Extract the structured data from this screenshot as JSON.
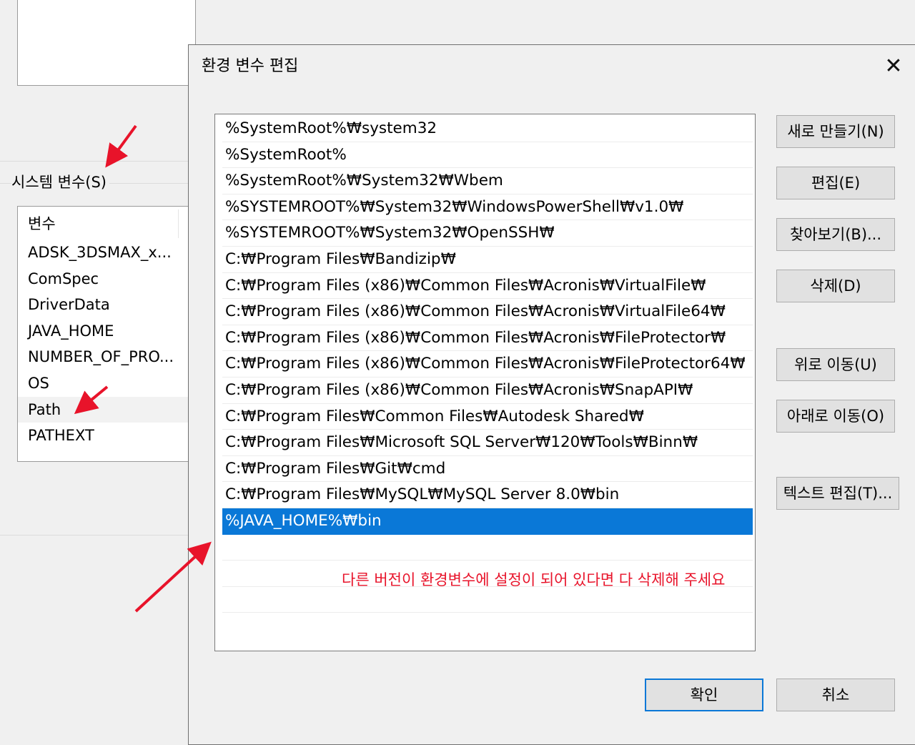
{
  "background": {
    "system_vars_group_label": "시스템 변수(S)",
    "list_header": "변수",
    "variables": [
      "ADSK_3DSMAX_x...",
      "ComSpec",
      "DriverData",
      "JAVA_HOME",
      "NUMBER_OF_PRO...",
      "OS",
      "Path",
      "PATHEXT"
    ],
    "highlighted_variable": "Path"
  },
  "dialog": {
    "title": "환경 변수 편집",
    "close_glyph": "✕",
    "entries": [
      "%SystemRoot%₩system32",
      "%SystemRoot%",
      "%SystemRoot%₩System32₩Wbem",
      "%SYSTEMROOT%₩System32₩WindowsPowerShell₩v1.0₩",
      "%SYSTEMROOT%₩System32₩OpenSSH₩",
      "C:₩Program Files₩Bandizip₩",
      "C:₩Program Files (x86)₩Common Files₩Acronis₩VirtualFile₩",
      "C:₩Program Files (x86)₩Common Files₩Acronis₩VirtualFile64₩",
      "C:₩Program Files (x86)₩Common Files₩Acronis₩FileProtector₩",
      "C:₩Program Files (x86)₩Common Files₩Acronis₩FileProtector64₩",
      "C:₩Program Files (x86)₩Common Files₩Acronis₩SnapAPI₩",
      "C:₩Program Files₩Common Files₩Autodesk Shared₩",
      "C:₩Program Files₩Microsoft SQL Server₩120₩Tools₩Binn₩",
      "C:₩Program Files₩Git₩cmd",
      "C:₩Program Files₩MySQL₩MySQL Server 8.0₩bin",
      "%JAVA_HOME%₩bin"
    ],
    "selected_entry": "%JAVA_HOME%₩bin",
    "note": "다른 버전이 환경변수에 설정이 되어 있다면 다 삭제해 주세요",
    "buttons": {
      "new": "새로 만들기(N)",
      "edit": "편집(E)",
      "browse": "찾아보기(B)...",
      "delete": "삭제(D)",
      "move_up": "위로 이동(U)",
      "move_down": "아래로 이동(O)",
      "edit_text": "텍스트 편집(T)...",
      "ok": "확인",
      "cancel": "취소"
    }
  },
  "colors": {
    "selection": "#0a78d7",
    "annotation": "#e8132a",
    "window_bg": "#f0f0f0"
  }
}
